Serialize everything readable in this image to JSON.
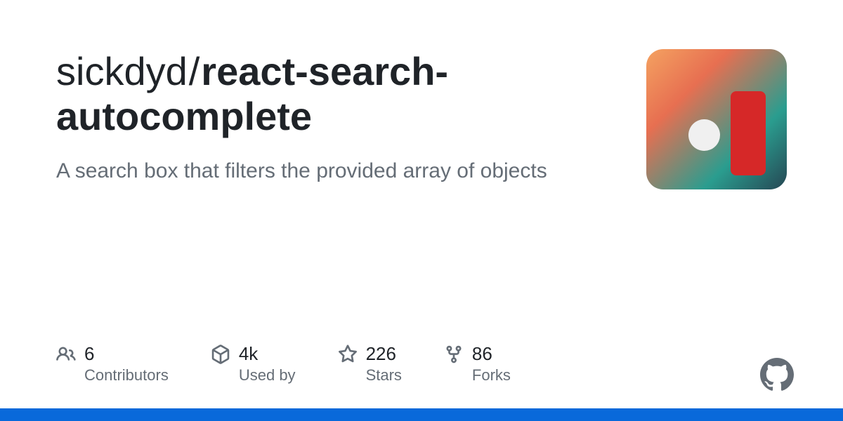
{
  "repo": {
    "owner": "sickdyd",
    "name": "react-search-autocomplete",
    "description": "A search box that filters the provided array of objects"
  },
  "stats": {
    "contributors": {
      "value": "6",
      "label": "Contributors"
    },
    "usedby": {
      "value": "4k",
      "label": "Used by"
    },
    "stars": {
      "value": "226",
      "label": "Stars"
    },
    "forks": {
      "value": "86",
      "label": "Forks"
    }
  }
}
